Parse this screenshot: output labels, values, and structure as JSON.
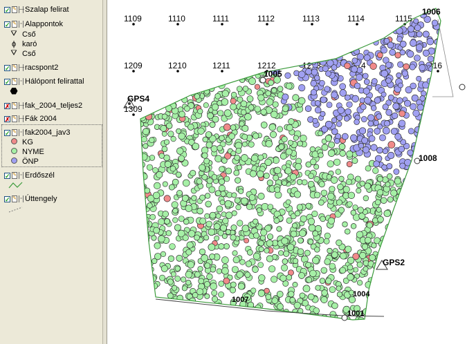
{
  "legend": {
    "layers": [
      {
        "label": "Szalap felirat",
        "checked": true
      },
      {
        "label": "Alappontok",
        "checked": true
      },
      {
        "label": "racspont2",
        "checked": true
      },
      {
        "label": "Hálópont felirattal",
        "checked": true
      },
      {
        "label": "fak_2004_teljes2",
        "checked": false
      },
      {
        "label": "Fák 2004",
        "checked": false
      },
      {
        "label": "fak2004_jav3",
        "checked": true
      },
      {
        "label": "Erdőszél",
        "checked": true
      },
      {
        "label": "Úttengely",
        "checked": true
      }
    ],
    "alappontok_items": [
      "Cső",
      "karó",
      "Cső"
    ],
    "fak_items": [
      {
        "label": "KG",
        "color": "#f08a8a"
      },
      {
        "label": "NYME",
        "color": "#a6f0a6"
      },
      {
        "label": "ÖNP",
        "color": "#a0a0f2"
      }
    ]
  },
  "map": {
    "grid_labels_row1": [
      "1109",
      "1110",
      "1111",
      "1112",
      "1113",
      "1114",
      "1115"
    ],
    "grid_labels_row2": [
      "1209",
      "1210",
      "1211",
      "1212",
      "1213",
      "1214",
      "216"
    ],
    "grid_label_1309": "1309",
    "points": {
      "gps4": "GPS4",
      "gps2": "GPS2",
      "p1005": "1005",
      "p1006": "1006",
      "p1008": "1008",
      "p1007": "1007",
      "p1001": "1001",
      "p1004": "1004"
    },
    "colors": {
      "kg": "#f08a8a",
      "nyme": "#a6f0a6",
      "onp": "#a0a0f2",
      "boundary": "#3a9a3a"
    }
  }
}
